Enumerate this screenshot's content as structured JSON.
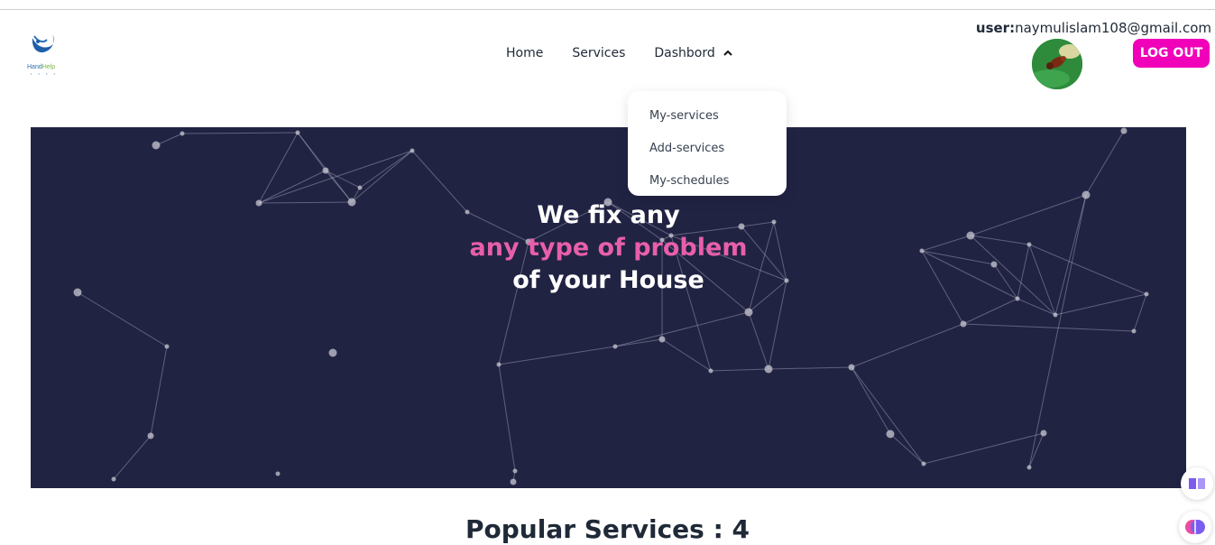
{
  "logo": {
    "brand_a": "Hand",
    "brand_b": "Help",
    "icon": "handhelp-logo-icon"
  },
  "nav": {
    "items": [
      {
        "label": "Home"
      },
      {
        "label": "Services"
      },
      {
        "label": "Dashbord"
      }
    ],
    "dropdown_icon": "chevron-up-icon"
  },
  "dropdown": {
    "items": [
      {
        "label": "My-services"
      },
      {
        "label": "Add-services"
      },
      {
        "label": "My-schedules"
      }
    ]
  },
  "user": {
    "label": "user:",
    "email": "naymulislam108@gmail.com",
    "logout_label": "LOG OUT"
  },
  "hero": {
    "line1": "We fix any",
    "line2": "any type of problem",
    "line3": "of your House"
  },
  "popular": {
    "title": "Popular Services : 4"
  },
  "colors": {
    "accent": "#f000b8",
    "hero_bg": "#212343",
    "highlight": "#e85fa9"
  },
  "floating_icons": [
    "book-icon",
    "brain-icon"
  ]
}
